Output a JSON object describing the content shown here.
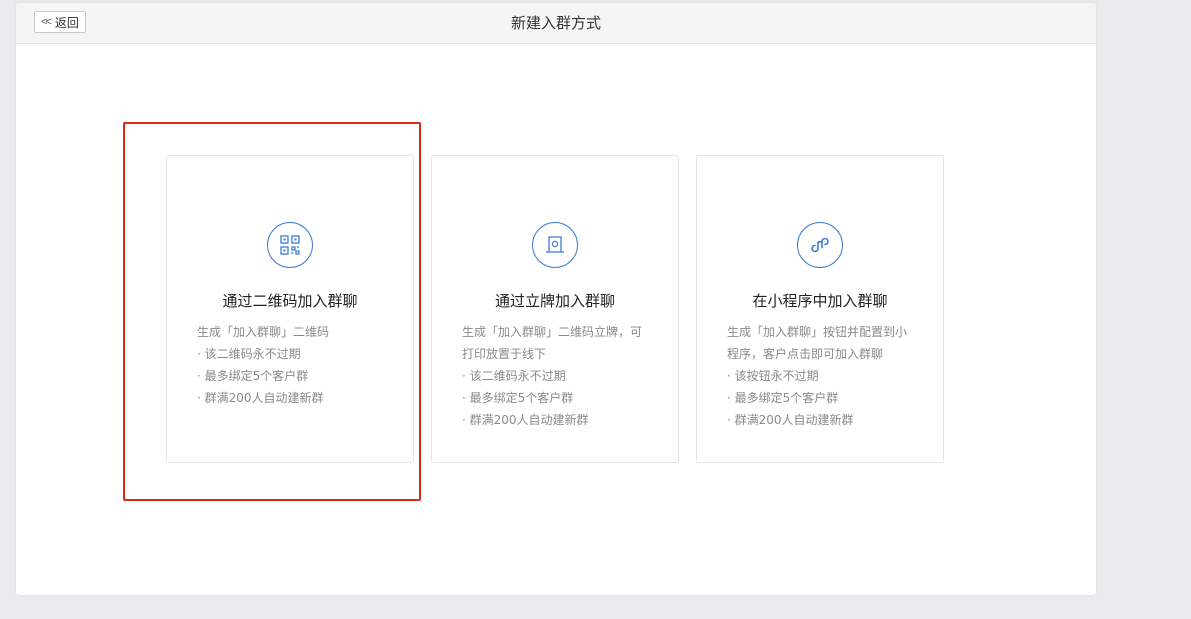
{
  "header": {
    "back_label": "返回",
    "title": "新建入群方式"
  },
  "cards": [
    {
      "icon": "qrcode-icon",
      "title": "通过二维码加入群聊",
      "desc": [
        "生成「加入群聊」二维码",
        "· 该二维码永不过期",
        "· 最多绑定5个客户群",
        "· 群满200人自动建新群"
      ]
    },
    {
      "icon": "standee-icon",
      "title": "通过立牌加入群聊",
      "desc": [
        "生成「加入群聊」二维码立牌，可",
        "打印放置于线下",
        "· 该二维码永不过期",
        "· 最多绑定5个客户群",
        "· 群满200人自动建新群"
      ]
    },
    {
      "icon": "miniprogram-icon",
      "title": "在小程序中加入群聊",
      "desc": [
        "生成「加入群聊」按钮并配置到小",
        "程序，客户点击即可加入群聊",
        "· 该按钮永不过期",
        "· 最多绑定5个客户群",
        "· 群满200人自动建新群"
      ]
    }
  ],
  "colors": {
    "accent": "#3a7bd5",
    "highlight": "#e1251b"
  }
}
